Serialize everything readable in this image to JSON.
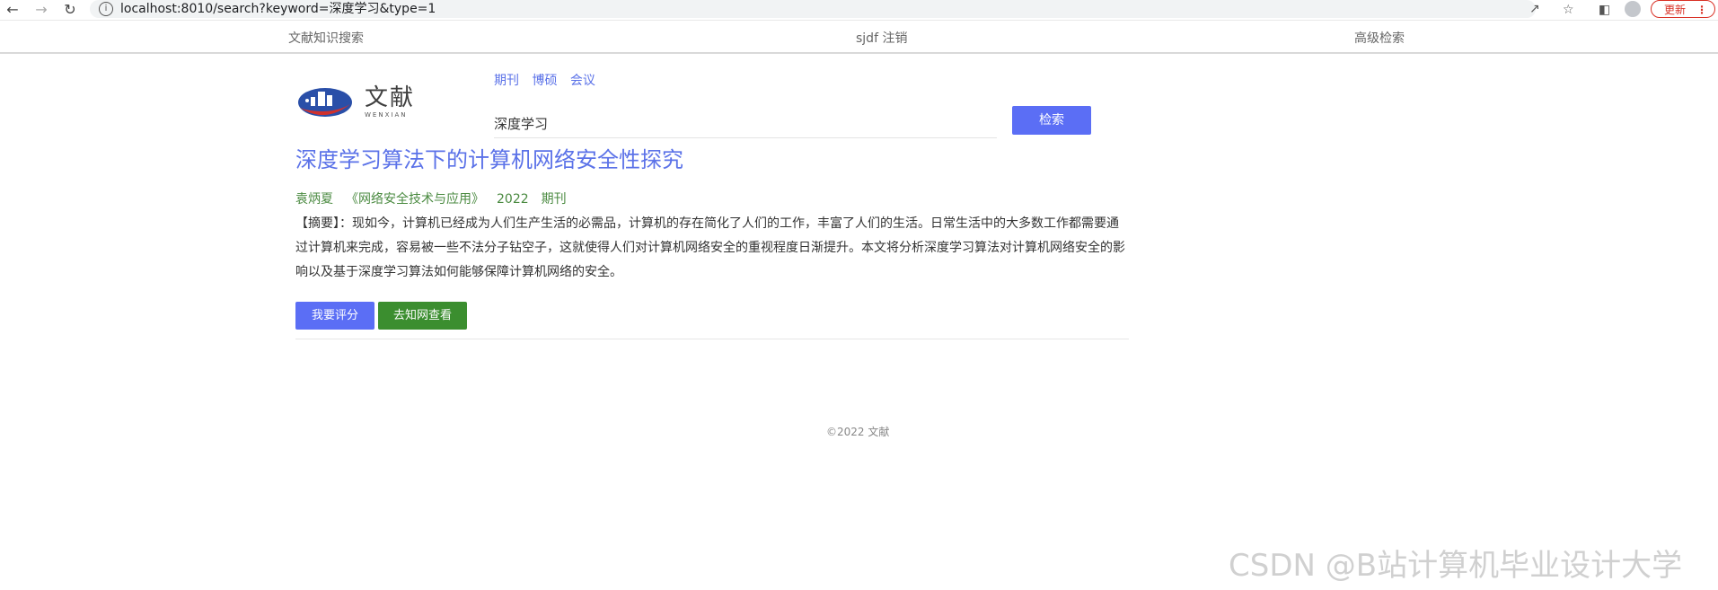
{
  "browser": {
    "url": "localhost:8010/search?keyword=深度学习&type=1",
    "update_label": "更新"
  },
  "topnav": {
    "home": "文献知识搜索",
    "user": "sjdf 注销",
    "advanced": "高级检索"
  },
  "logo": {
    "title": "文献",
    "subtitle": "WENXIAN"
  },
  "type_tabs": [
    "期刊",
    "博硕",
    "会议"
  ],
  "search": {
    "value": "深度学习",
    "button": "检索"
  },
  "result": {
    "title": "深度学习算法下的计算机网络安全性探究",
    "author": "袁炳夏",
    "journal": "《网络安全技术与应用》",
    "year": "2022",
    "type": "期刊",
    "abstract": "【摘要】：现如今，计算机已经成为人们生产生活的必需品，计算机的存在简化了人们的工作，丰富了人们的生活。日常生活中的大多数工作都需要通过计算机来完成，容易被一些不法分子钻空子，这就使得人们对计算机网络安全的重视程度日渐提升。本文将分析深度学习算法对计算机网络安全的影响以及基于深度学习算法如何能够保障计算机网络的安全。",
    "rate_button": "我要评分",
    "cnki_button": "去知网查看"
  },
  "footer": "©2022 文献",
  "watermark": "CSDN @B站计算机毕业设计大学",
  "colors": {
    "accent": "#5b6ef5",
    "link": "#5b72e8",
    "green": "#3b8e2f",
    "meta": "#4a8a40"
  }
}
